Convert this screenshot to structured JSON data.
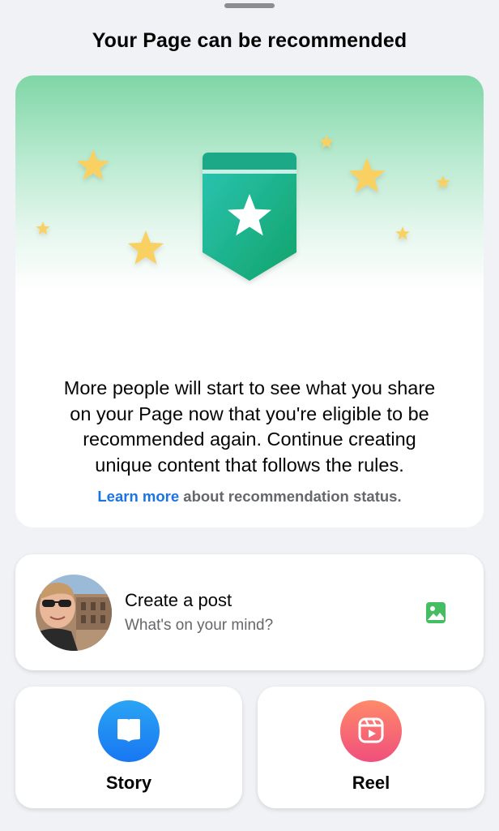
{
  "sheet": {
    "title": "Your Page can be recommended"
  },
  "hero": {
    "illustration": "green-badge-with-star-icon",
    "body_lines": [
      "More people will start to see what you share",
      "on your Page now that you're eligible to be",
      "recommended again. Continue creating",
      "unique content that follows the rules."
    ],
    "learn_more_link": "Learn more",
    "learn_more_suffix": " about recommendation status.",
    "colors": {
      "link": "#1b74e4",
      "badge": "#17a589",
      "star": "#f9d162"
    }
  },
  "create_post": {
    "title": "Create a post",
    "placeholder": "What's on your mind?",
    "avatar_icon": "profile-photo-avatar",
    "photo_icon": "photo-icon",
    "photo_icon_color": "#45bd62"
  },
  "actions": [
    {
      "label": "Story",
      "icon": "book-icon",
      "color": "#1877f2"
    },
    {
      "label": "Reel",
      "icon": "reel-play-icon",
      "color": "#f25268"
    }
  ]
}
